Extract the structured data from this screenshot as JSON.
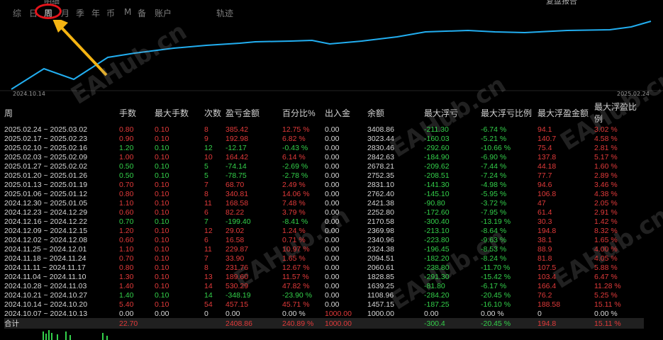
{
  "header": {
    "title_cut": "明细",
    "right_cut": "复盘报告"
  },
  "tabs": [
    {
      "label": "综",
      "active": false
    },
    {
      "label": "日",
      "active": false
    },
    {
      "label": "周",
      "active": true
    },
    {
      "label": "月",
      "active": false
    },
    {
      "label": "季",
      "active": false
    },
    {
      "label": "年",
      "active": false
    },
    {
      "label": "币",
      "active": false
    },
    {
      "label": "M",
      "active": false
    },
    {
      "label": "备",
      "active": false
    },
    {
      "label": "账户",
      "active": false
    },
    {
      "label": "轨迹",
      "active": false
    }
  ],
  "chart": {
    "start_date": "2024.10.14",
    "end_date": "2025.02.24",
    "line_color": "#22aef0"
  },
  "watermark": "EAHub.cn",
  "table": {
    "columns": [
      "周",
      "手数",
      "最大手数",
      "次数",
      "盈亏金额",
      "百分比%",
      "出入金",
      "余额",
      "最大浮亏",
      "最大浮亏比例",
      "最大浮盈金额",
      "最大浮盈比例"
    ],
    "rows": [
      {
        "week": "2025.02.24 ~ 2025.03.02",
        "lots": "0.80",
        "max_lots": "0.10",
        "count": "8",
        "pnl": "385.42",
        "pct": "12.75 %",
        "flow": "0.00",
        "balance": "3408.86",
        "max_dd": "-211.30",
        "max_dd_pct": "-6.74 %",
        "max_gain": "94.1",
        "max_gain_pct": "3.02 %",
        "s": "pos"
      },
      {
        "week": "2025.02.17 ~ 2025.02.23",
        "lots": "0.90",
        "max_lots": "0.10",
        "count": "9",
        "pnl": "192.98",
        "pct": "6.82 %",
        "flow": "0.00",
        "balance": "3023.44",
        "max_dd": "-160.03",
        "max_dd_pct": "-5.21 %",
        "max_gain": "140.7",
        "max_gain_pct": "4.58 %",
        "s": "pos"
      },
      {
        "week": "2025.02.10 ~ 2025.02.16",
        "lots": "1.20",
        "max_lots": "0.10",
        "count": "12",
        "pnl": "-12.17",
        "pct": "-0.43 %",
        "flow": "0.00",
        "balance": "2830.46",
        "max_dd": "-292.60",
        "max_dd_pct": "-10.66 %",
        "max_gain": "75.4",
        "max_gain_pct": "2.81 %",
        "s": "neg"
      },
      {
        "week": "2025.02.03 ~ 2025.02.09",
        "lots": "1.00",
        "max_lots": "0.10",
        "count": "10",
        "pnl": "164.42",
        "pct": "6.14 %",
        "flow": "0.00",
        "balance": "2842.63",
        "max_dd": "-184.90",
        "max_dd_pct": "-6.90 %",
        "max_gain": "137.8",
        "max_gain_pct": "5.17 %",
        "s": "pos"
      },
      {
        "week": "2025.01.27 ~ 2025.02.02",
        "lots": "0.50",
        "max_lots": "0.10",
        "count": "5",
        "pnl": "-74.14",
        "pct": "-2.69 %",
        "flow": "0.00",
        "balance": "2678.21",
        "max_dd": "-209.62",
        "max_dd_pct": "-7.44 %",
        "max_gain": "44.18",
        "max_gain_pct": "1.60 %",
        "s": "neg"
      },
      {
        "week": "2025.01.20 ~ 2025.01.26",
        "lots": "0.50",
        "max_lots": "0.10",
        "count": "5",
        "pnl": "-78.75",
        "pct": "-2.78 %",
        "flow": "0.00",
        "balance": "2752.35",
        "max_dd": "-208.51",
        "max_dd_pct": "-7.24 %",
        "max_gain": "77.7",
        "max_gain_pct": "2.89 %",
        "s": "neg"
      },
      {
        "week": "2025.01.13 ~ 2025.01.19",
        "lots": "0.70",
        "max_lots": "0.10",
        "count": "7",
        "pnl": "68.70",
        "pct": "2.49 %",
        "flow": "0.00",
        "balance": "2831.10",
        "max_dd": "-141.30",
        "max_dd_pct": "-4.98 %",
        "max_gain": "94.6",
        "max_gain_pct": "3.46 %",
        "s": "pos"
      },
      {
        "week": "2025.01.06 ~ 2025.01.12",
        "lots": "0.80",
        "max_lots": "0.10",
        "count": "8",
        "pnl": "340.81",
        "pct": "14.06 %",
        "flow": "0.00",
        "balance": "2762.40",
        "max_dd": "-145.10",
        "max_dd_pct": "-5.95 %",
        "max_gain": "106.8",
        "max_gain_pct": "4.38 %",
        "s": "pos"
      },
      {
        "week": "2024.12.30 ~ 2025.01.05",
        "lots": "1.10",
        "max_lots": "0.10",
        "count": "11",
        "pnl": "168.58",
        "pct": "7.48 %",
        "flow": "0.00",
        "balance": "2421.38",
        "max_dd": "-90.80",
        "max_dd_pct": "-3.72 %",
        "max_gain": "47",
        "max_gain_pct": "2.05 %",
        "s": "pos"
      },
      {
        "week": "2024.12.23 ~ 2024.12.29",
        "lots": "0.60",
        "max_lots": "0.10",
        "count": "6",
        "pnl": "82.22",
        "pct": "3.79 %",
        "flow": "0.00",
        "balance": "2252.80",
        "max_dd": "-172.60",
        "max_dd_pct": "-7.95 %",
        "max_gain": "61.4",
        "max_gain_pct": "2.91 %",
        "s": "pos"
      },
      {
        "week": "2024.12.16 ~ 2024.12.22",
        "lots": "0.70",
        "max_lots": "0.10",
        "count": "7",
        "pnl": "-199.40",
        "pct": "-8.41 %",
        "flow": "0.00",
        "balance": "2170.58",
        "max_dd": "-300.40",
        "max_dd_pct": "-13.19 %",
        "max_gain": "30.3",
        "max_gain_pct": "1.42 %",
        "s": "neg"
      },
      {
        "week": "2024.12.09 ~ 2024.12.15",
        "lots": "1.20",
        "max_lots": "0.10",
        "count": "12",
        "pnl": "29.02",
        "pct": "1.24 %",
        "flow": "0.00",
        "balance": "2369.98",
        "max_dd": "-213.10",
        "max_dd_pct": "-8.64 %",
        "max_gain": "194.8",
        "max_gain_pct": "8.32 %",
        "s": "pos"
      },
      {
        "week": "2024.12.02 ~ 2024.12.08",
        "lots": "0.60",
        "max_lots": "0.10",
        "count": "6",
        "pnl": "16.58",
        "pct": "0.71 %",
        "flow": "0.00",
        "balance": "2340.96",
        "max_dd": "-223.80",
        "max_dd_pct": "-9.63 %",
        "max_gain": "38.1",
        "max_gain_pct": "1.65 %",
        "s": "pos"
      },
      {
        "week": "2024.11.25 ~ 2024.12.01",
        "lots": "1.10",
        "max_lots": "0.10",
        "count": "11",
        "pnl": "229.87",
        "pct": "10.97 %",
        "flow": "0.00",
        "balance": "2324.38",
        "max_dd": "-196.45",
        "max_dd_pct": "-8.53 %",
        "max_gain": "88.9",
        "max_gain_pct": "4.00 %",
        "s": "pos"
      },
      {
        "week": "2024.11.18 ~ 2024.11.24",
        "lots": "0.70",
        "max_lots": "0.10",
        "count": "7",
        "pnl": "33.90",
        "pct": "1.65 %",
        "flow": "0.00",
        "balance": "2094.51",
        "max_dd": "-182.20",
        "max_dd_pct": "-8.24 %",
        "max_gain": "81.8",
        "max_gain_pct": "4.05 %",
        "s": "pos"
      },
      {
        "week": "2024.11.11 ~ 2024.11.17",
        "lots": "0.80",
        "max_lots": "0.10",
        "count": "8",
        "pnl": "231.76",
        "pct": "12.67 %",
        "flow": "0.00",
        "balance": "2060.61",
        "max_dd": "-238.80",
        "max_dd_pct": "-11.70 %",
        "max_gain": "107.5",
        "max_gain_pct": "5.88 %",
        "s": "pos"
      },
      {
        "week": "2024.11.04 ~ 2024.11.10",
        "lots": "1.30",
        "max_lots": "0.10",
        "count": "13",
        "pnl": "189.60",
        "pct": "11.57 %",
        "flow": "0.00",
        "balance": "1828.85",
        "max_dd": "-291.30",
        "max_dd_pct": "-15.42 %",
        "max_gain": "103.4",
        "max_gain_pct": "6.47 %",
        "s": "pos"
      },
      {
        "week": "2024.10.28 ~ 2024.11.03",
        "lots": "1.40",
        "max_lots": "0.10",
        "count": "14",
        "pnl": "530.29",
        "pct": "47.82 %",
        "flow": "0.00",
        "balance": "1639.25",
        "max_dd": "-81.80",
        "max_dd_pct": "-6.17 %",
        "max_gain": "166.4",
        "max_gain_pct": "11.28 %",
        "s": "pos"
      },
      {
        "week": "2024.10.21 ~ 2024.10.27",
        "lots": "1.40",
        "max_lots": "0.10",
        "count": "14",
        "pnl": "-348.19",
        "pct": "-23.90 %",
        "flow": "0.00",
        "balance": "1108.96",
        "max_dd": "-284.20",
        "max_dd_pct": "-20.45 %",
        "max_gain": "76.2",
        "max_gain_pct": "5.25 %",
        "s": "neg"
      },
      {
        "week": "2024.10.14 ~ 2024.10.20",
        "lots": "5.40",
        "max_lots": "0.10",
        "count": "54",
        "pnl": "457.15",
        "pct": "45.71 %",
        "flow": "0.00",
        "balance": "1457.15",
        "max_dd": "-187.25",
        "max_dd_pct": "-16.10 %",
        "max_gain": "188.58",
        "max_gain_pct": "15.11 %",
        "s": "pos"
      },
      {
        "week": "2024.10.07 ~ 2024.10.13",
        "lots": "0.00",
        "max_lots": "0.00",
        "count": "0",
        "pnl": "0.00",
        "pct": "0.00 %",
        "flow": "1000.00",
        "balance": "1000.00",
        "max_dd": "0.00",
        "max_dd_pct": "0.00 %",
        "max_gain": "0",
        "max_gain_pct": "0.00 %",
        "s": "zero"
      }
    ],
    "total": {
      "label": "合计",
      "lots": "22.70",
      "pnl": "2408.86",
      "pct": "240.89 %",
      "flow": "1000.00",
      "max_dd": "-300.4",
      "max_dd_pct": "-20.45 %",
      "max_gain": "194.8",
      "max_gain_pct": "15.11 %"
    }
  },
  "colors": {
    "profit": "#e23a3a",
    "loss": "#33d04a",
    "highlight": "#e4141b",
    "arrow": "#f5b412"
  }
}
